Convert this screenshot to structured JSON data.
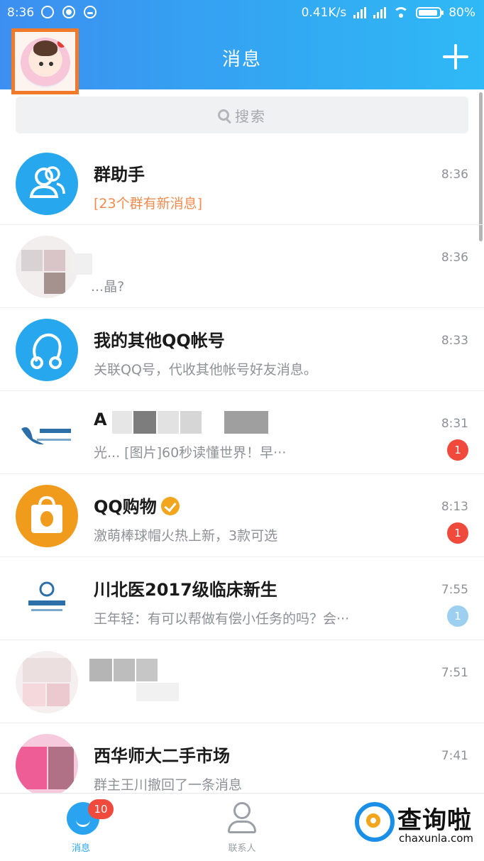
{
  "status_bar": {
    "time": "8:36",
    "network_speed": "0.41K/s",
    "battery": "80%"
  },
  "header": {
    "title": "消息"
  },
  "search": {
    "placeholder": "搜索"
  },
  "conversations": [
    {
      "name": "群助手",
      "message": "[23个群有新消息]",
      "time": "8:36",
      "badge": ""
    },
    {
      "name": "",
      "message": "...晶?",
      "time": "8:36",
      "badge": ""
    },
    {
      "name": "我的其他QQ帐号",
      "message": "关联QQ号，代收其他帐号好友消息。",
      "time": "8:33",
      "badge": ""
    },
    {
      "name": "A",
      "message": "光... [图片]60秒读懂世界！早···",
      "time": "8:31",
      "badge": "1"
    },
    {
      "name": "QQ购物",
      "message": "激萌棒球帽火热上新，3款可选",
      "time": "8:13",
      "badge": "1"
    },
    {
      "name": "川北医2017级临床新生",
      "message": "王年轻：有可以帮做有偿小任务的吗？会···",
      "time": "7:55",
      "badge": "1"
    },
    {
      "name": "",
      "message": "",
      "time": "7:51",
      "badge": ""
    },
    {
      "name": "西华师大二手市场",
      "message": "群主王川撤回了一条消息",
      "time": "7:41",
      "badge": ""
    }
  ],
  "tabbar": {
    "tabs": [
      {
        "label": "消息",
        "badge": "10"
      },
      {
        "label": "联系人"
      }
    ]
  },
  "watermark": {
    "title": "查询啦",
    "subtitle": "chaxunla.com"
  },
  "colors": {
    "header_start": "#3c8ff0",
    "header_end": "#2fb9f6",
    "badge": "#f04a3c",
    "accent": "#2aa4f0",
    "highlight_frame": "#f07a2a"
  }
}
